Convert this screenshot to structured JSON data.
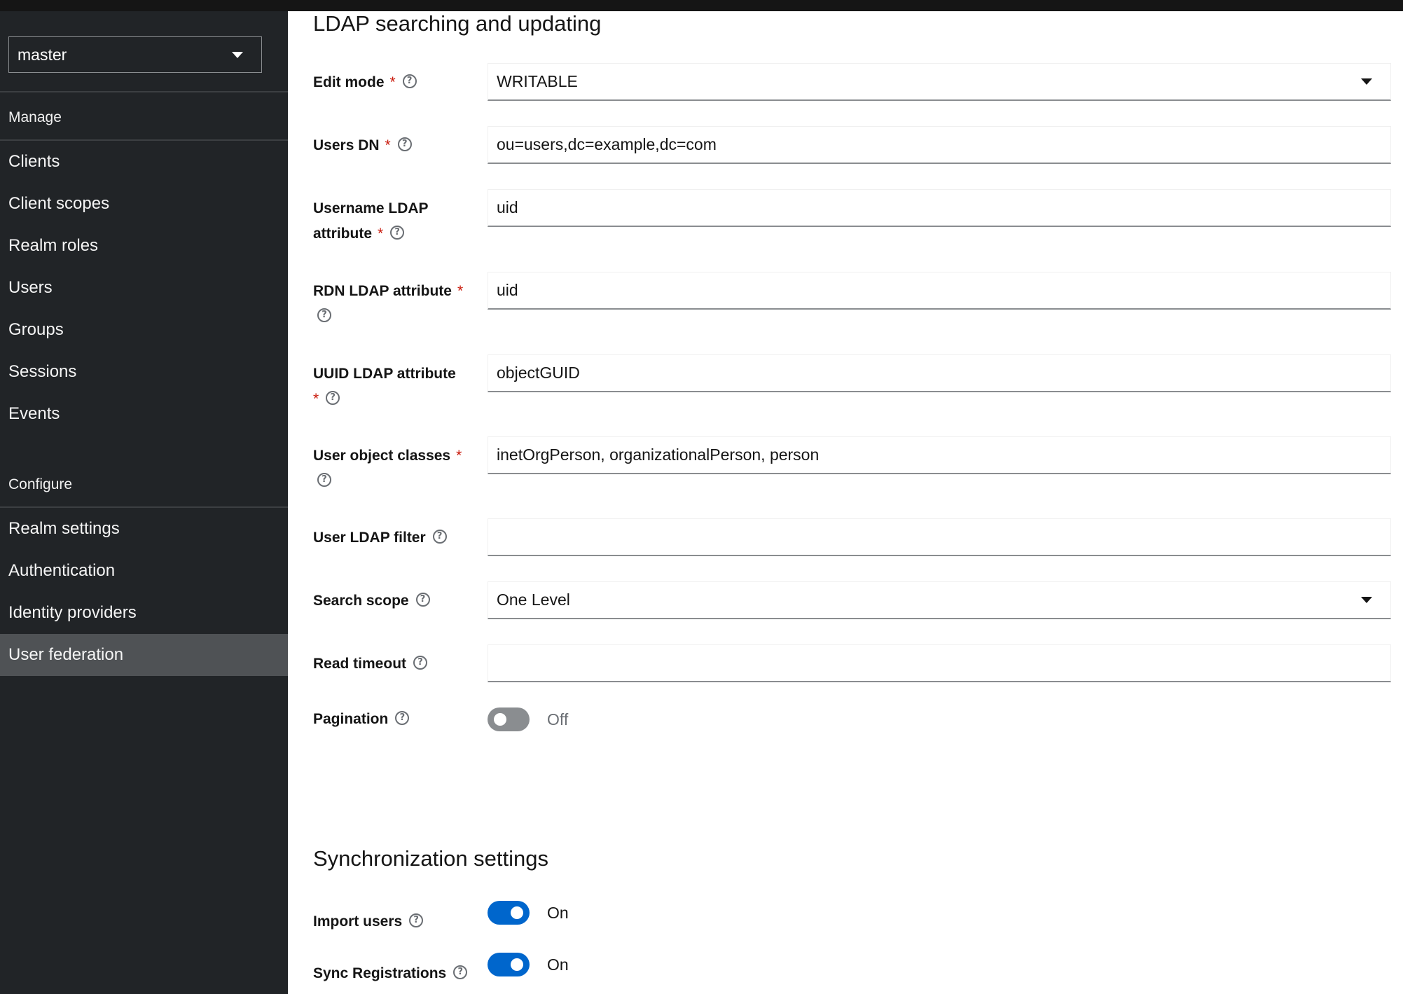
{
  "sidebar": {
    "realm": "master",
    "sections": {
      "manage": "Manage",
      "configure": "Configure"
    },
    "manage_items": [
      "Clients",
      "Client scopes",
      "Realm roles",
      "Users",
      "Groups",
      "Sessions",
      "Events"
    ],
    "configure_items": [
      "Realm settings",
      "Authentication",
      "Identity providers",
      "User federation"
    ],
    "active_item": "User federation"
  },
  "ldap": {
    "title": "LDAP searching and updating",
    "edit_mode": {
      "label": "Edit mode",
      "value": "WRITABLE"
    },
    "users_dn": {
      "label": "Users DN",
      "value": "ou=users,dc=example,dc=com"
    },
    "username_attr": {
      "label_line1": "Username LDAP",
      "label_line2": "attribute",
      "value": "uid"
    },
    "rdn_attr": {
      "label": "RDN LDAP attribute",
      "value": "uid"
    },
    "uuid_attr": {
      "label": "UUID LDAP attribute",
      "value": "objectGUID"
    },
    "object_classes": {
      "label": "User object classes",
      "value": "inetOrgPerson, organizationalPerson, person"
    },
    "ldap_filter": {
      "label": "User LDAP filter",
      "value": ""
    },
    "search_scope": {
      "label": "Search scope",
      "value": "One Level"
    },
    "read_timeout": {
      "label": "Read timeout",
      "value": ""
    },
    "pagination": {
      "label": "Pagination",
      "state": "Off"
    }
  },
  "sync": {
    "title": "Synchronization settings",
    "import_users": {
      "label": "Import users",
      "state": "On"
    },
    "sync_registrations": {
      "label": "Sync Registrations",
      "state": "On"
    }
  },
  "required_marker": "*",
  "help_glyph": "?",
  "colors": {
    "sidebar_bg": "#212427",
    "sidebar_active": "#4f5255",
    "accent": "#0066cc",
    "required": "#c9190b"
  }
}
